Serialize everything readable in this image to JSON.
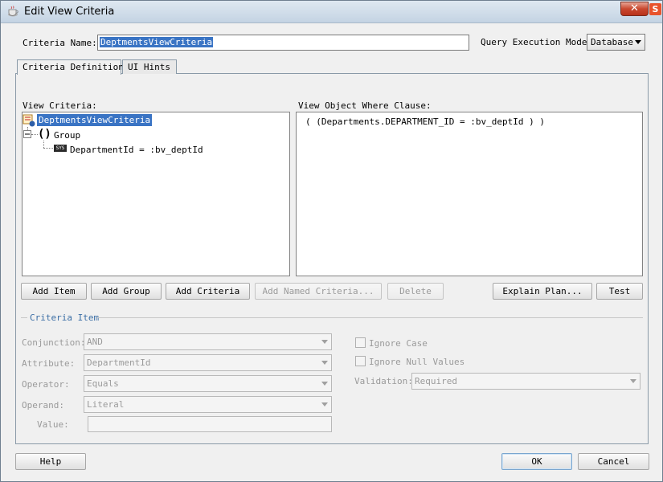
{
  "window": {
    "title": "Edit View Criteria",
    "close_glyph": "✕",
    "badge": "S"
  },
  "criteria_name": {
    "label": "Criteria Name:",
    "value": "DeptmentsViewCriteria"
  },
  "query_execution_mode": {
    "label": "Query Execution Mode:",
    "value": "Database"
  },
  "tabs": [
    {
      "label": "Criteria Definition",
      "active": true
    },
    {
      "label": "UI Hints",
      "active": false
    }
  ],
  "view_criteria": {
    "label": "View Criteria:",
    "tree": {
      "root": "DeptmentsViewCriteria",
      "group_symbol": "()",
      "group": "Group",
      "item_badge": "SYS",
      "item": "DepartmentId = :bv_deptId"
    }
  },
  "where_clause": {
    "label": "View Object Where Clause:",
    "text": "( (Departments.DEPARTMENT_ID = :bv_deptId ) )"
  },
  "buttons": {
    "add_item": "Add Item",
    "add_group": "Add Group",
    "add_criteria": "Add Criteria",
    "add_named_criteria": "Add Named Criteria...",
    "delete": "Delete",
    "explain_plan": "Explain Plan...",
    "test": "Test",
    "help": "Help",
    "ok": "OK",
    "cancel": "Cancel"
  },
  "criteria_item": {
    "legend": "Criteria Item",
    "conjunction": {
      "label": "Conjunction:",
      "value": "AND"
    },
    "attribute": {
      "label": "Attribute:",
      "value": "DepartmentId"
    },
    "operator": {
      "label": "Operator:",
      "value": "Equals"
    },
    "operand": {
      "label": "Operand:",
      "value": "Literal"
    },
    "value": {
      "label": "Value:",
      "value": ""
    },
    "ignore_case": {
      "label": "Ignore Case",
      "checked": false
    },
    "ignore_null_values": {
      "label": "Ignore Null Values",
      "checked": false
    },
    "validation": {
      "label": "Validation:",
      "value": "Required"
    }
  },
  "colors": {
    "selection": "#3a74c4",
    "close_button": "#c9482f",
    "legend_text": "#3b6ea5"
  }
}
